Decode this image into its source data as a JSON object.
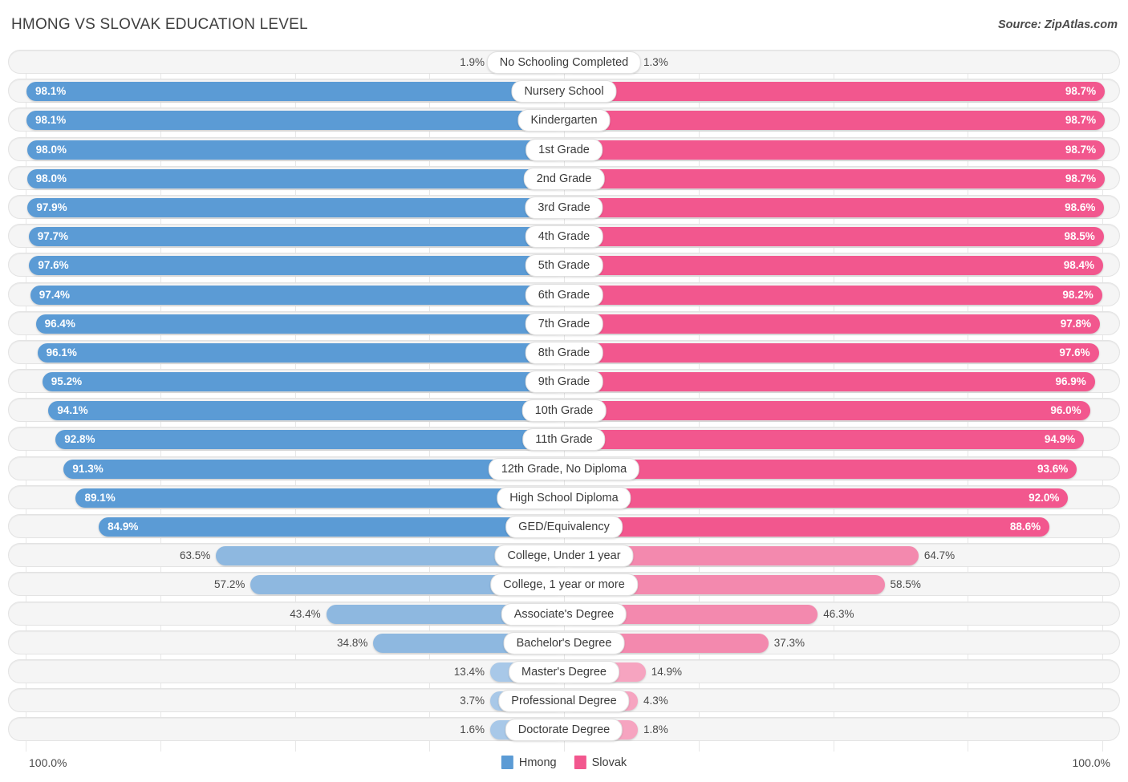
{
  "header": {
    "title": "HMONG VS SLOVAK EDUCATION LEVEL",
    "source": "Source: ZipAtlas.com"
  },
  "footer": {
    "axis_min": "100.0%",
    "axis_max": "100.0%",
    "legend": [
      {
        "label": "Hmong",
        "color": "#5B9BD5"
      },
      {
        "label": "Slovak",
        "color": "#F2578E"
      }
    ]
  },
  "colors": {
    "left_strong": "#5B9BD5",
    "left_mid": "#8EB8E0",
    "left_light": "#A8C8E8",
    "right_strong": "#F2578E",
    "right_mid": "#F389AE",
    "right_light": "#F6A4C0",
    "track": "#F5F5F5",
    "track_border": "#E3E3E3"
  },
  "chart_data": {
    "type": "bar",
    "title": "HMONG VS SLOVAK EDUCATION LEVEL",
    "subtitle": "",
    "xlabel": "",
    "ylabel": "",
    "orientation": "horizontal-diverging",
    "axis_max": 100.0,
    "legend_position": "bottom-center",
    "grid": true,
    "categories": [
      "No Schooling Completed",
      "Nursery School",
      "Kindergarten",
      "1st Grade",
      "2nd Grade",
      "3rd Grade",
      "4th Grade",
      "5th Grade",
      "6th Grade",
      "7th Grade",
      "8th Grade",
      "9th Grade",
      "10th Grade",
      "11th Grade",
      "12th Grade, No Diploma",
      "High School Diploma",
      "GED/Equivalency",
      "College, Under 1 year",
      "College, 1 year or more",
      "Associate's Degree",
      "Bachelor's Degree",
      "Master's Degree",
      "Professional Degree",
      "Doctorate Degree"
    ],
    "series": [
      {
        "name": "Hmong",
        "color": "#5B9BD5",
        "side": "left",
        "values": [
          1.9,
          98.1,
          98.1,
          98.0,
          98.0,
          97.9,
          97.7,
          97.6,
          97.4,
          96.4,
          96.1,
          95.2,
          94.1,
          92.8,
          91.3,
          89.1,
          84.9,
          63.5,
          57.2,
          43.4,
          34.8,
          13.4,
          3.7,
          1.6
        ],
        "labels": [
          "1.9%",
          "98.1%",
          "98.1%",
          "98.0%",
          "98.0%",
          "97.9%",
          "97.7%",
          "97.6%",
          "97.4%",
          "96.4%",
          "96.1%",
          "95.2%",
          "94.1%",
          "92.8%",
          "91.3%",
          "89.1%",
          "84.9%",
          "63.5%",
          "57.2%",
          "43.4%",
          "34.8%",
          "13.4%",
          "3.7%",
          "1.6%"
        ]
      },
      {
        "name": "Slovak",
        "color": "#F2578E",
        "side": "right",
        "values": [
          1.3,
          98.7,
          98.7,
          98.7,
          98.7,
          98.6,
          98.5,
          98.4,
          98.2,
          97.8,
          97.6,
          96.9,
          96.0,
          94.9,
          93.6,
          92.0,
          88.6,
          64.7,
          58.5,
          46.3,
          37.3,
          14.9,
          4.3,
          1.8
        ],
        "labels": [
          "1.3%",
          "98.7%",
          "98.7%",
          "98.7%",
          "98.7%",
          "98.6%",
          "98.5%",
          "98.4%",
          "98.2%",
          "97.8%",
          "97.6%",
          "96.9%",
          "96.0%",
          "94.9%",
          "93.6%",
          "92.0%",
          "88.6%",
          "64.7%",
          "58.5%",
          "46.3%",
          "37.3%",
          "14.9%",
          "4.3%",
          "1.8%"
        ]
      }
    ]
  }
}
